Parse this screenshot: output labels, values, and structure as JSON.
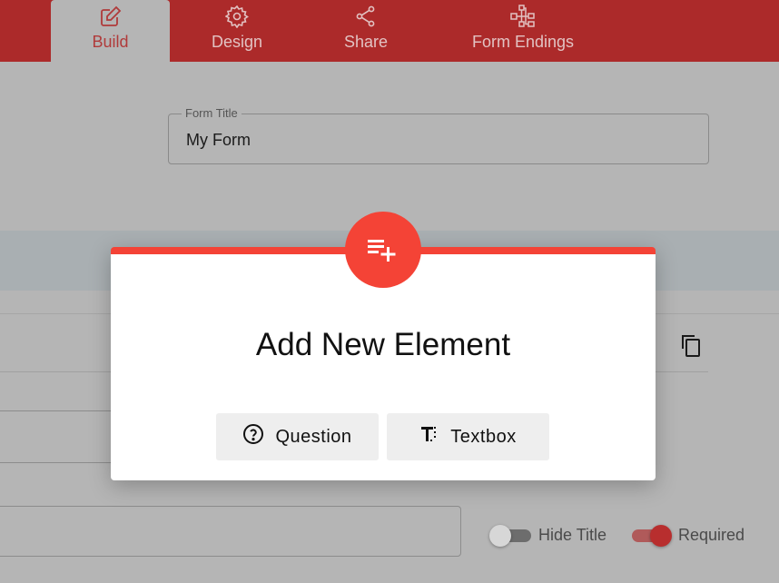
{
  "nav": {
    "tabs": [
      {
        "label": "Build",
        "icon": "edit-icon",
        "active": true
      },
      {
        "label": "Design",
        "icon": "gear-icon",
        "active": false
      },
      {
        "label": "Share",
        "icon": "share-icon",
        "active": false
      },
      {
        "label": "Form Endings",
        "icon": "flow-icon",
        "active": false
      }
    ]
  },
  "form": {
    "title_label": "Form Title",
    "title_value": "My Form"
  },
  "toggles": {
    "hide_title": {
      "label": "Hide Title",
      "on": false
    },
    "required": {
      "label": "Required",
      "on": true
    }
  },
  "modal": {
    "icon": "playlist-add-icon",
    "title": "Add New Element",
    "buttons": [
      {
        "label": "Question",
        "icon": "help-circle-icon"
      },
      {
        "label": "Textbox",
        "icon": "text-format-icon"
      }
    ]
  },
  "colors": {
    "header": "#ac2a2a",
    "accent": "#f44336",
    "overlay_bg": "#b5b5b5"
  }
}
